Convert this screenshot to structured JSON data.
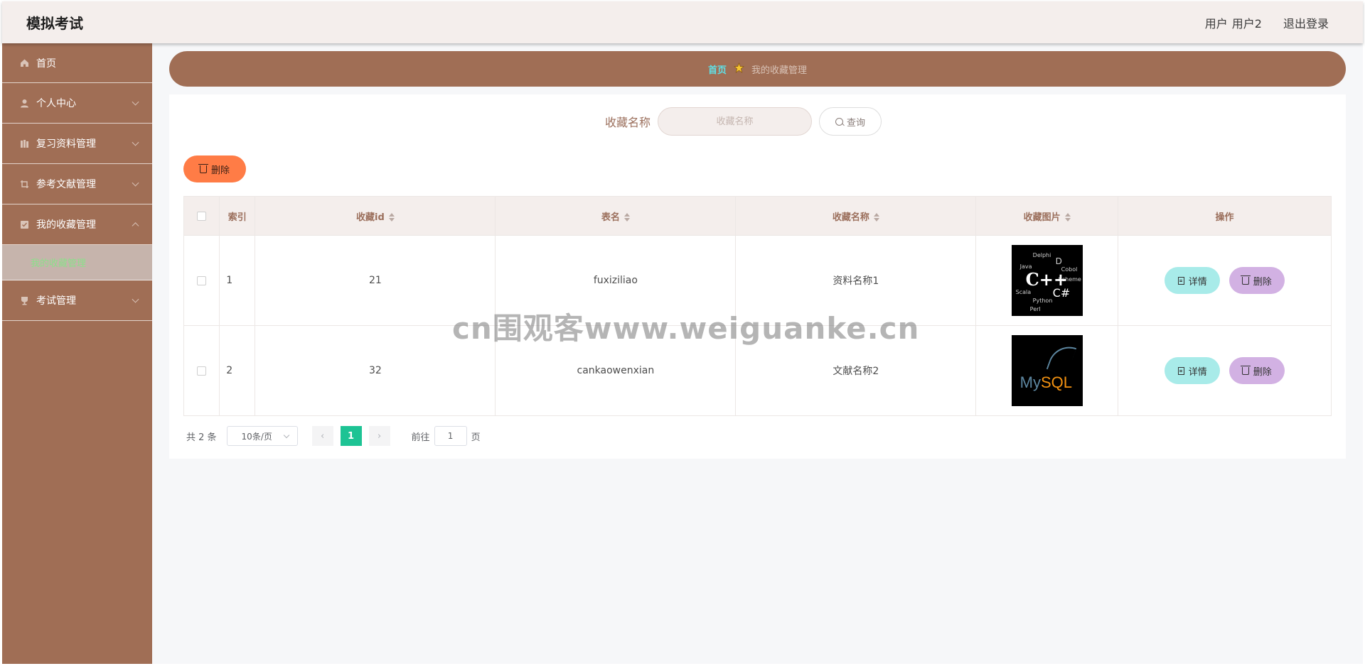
{
  "app": {
    "title": "模拟考试"
  },
  "header": {
    "role": "用户",
    "username": "用户2",
    "logout": "退出登录"
  },
  "sidebar": {
    "items": [
      {
        "label": "首页",
        "icon": "home-icon"
      },
      {
        "label": "个人中心",
        "icon": "user-icon"
      },
      {
        "label": "复习资料管理",
        "icon": "books-icon"
      },
      {
        "label": "参考文献管理",
        "icon": "crop-icon"
      },
      {
        "label": "我的收藏管理",
        "icon": "checkbox-icon"
      },
      {
        "label": "考试管理",
        "icon": "trophy-icon"
      }
    ],
    "submenu": {
      "label": "我的收藏管理"
    }
  },
  "breadcrumb": {
    "home": "首页",
    "current": "我的收藏管理"
  },
  "search": {
    "label": "收藏名称",
    "placeholder": "收藏名称",
    "button": "查询"
  },
  "toolbar": {
    "delete_label": "删除"
  },
  "table": {
    "headers": {
      "index": "索引",
      "id": "收藏id",
      "table_name": "表名",
      "name": "收藏名称",
      "image": "收藏图片",
      "actions": "操作"
    },
    "rows": [
      {
        "index": "1",
        "id": "21",
        "table_name": "fuxiziliao",
        "name": "资料名称1",
        "image": "cpp-logo-image"
      },
      {
        "index": "2",
        "id": "32",
        "table_name": "cankaowenxian",
        "name": "文献名称2",
        "image": "mysql-logo-image"
      }
    ],
    "detail_label": "详情",
    "delete_label": "删除"
  },
  "thumb_cpp": {
    "main": "C++",
    "words": [
      "Delphi",
      "Java",
      "D",
      "Cobol",
      "Scheme",
      "Scala",
      "Python",
      "C#",
      "Perl"
    ]
  },
  "thumb_sql": {
    "my": "My",
    "sql": "SQL"
  },
  "pagination": {
    "total": "共 2 条",
    "page_size": "10条/页",
    "current_page": "1",
    "goto_prefix": "前往",
    "goto_value": "1",
    "goto_suffix": "页"
  },
  "watermark": "cn围观客www.weiguanke.cn",
  "colors": {
    "sidebar": "#a06e55",
    "header": "#f4eeec",
    "accent_delete": "#ff7c46",
    "page_active": "#1dc394",
    "detail_btn": "#a8ebe9",
    "delete_btn": "#d2b1e3"
  }
}
